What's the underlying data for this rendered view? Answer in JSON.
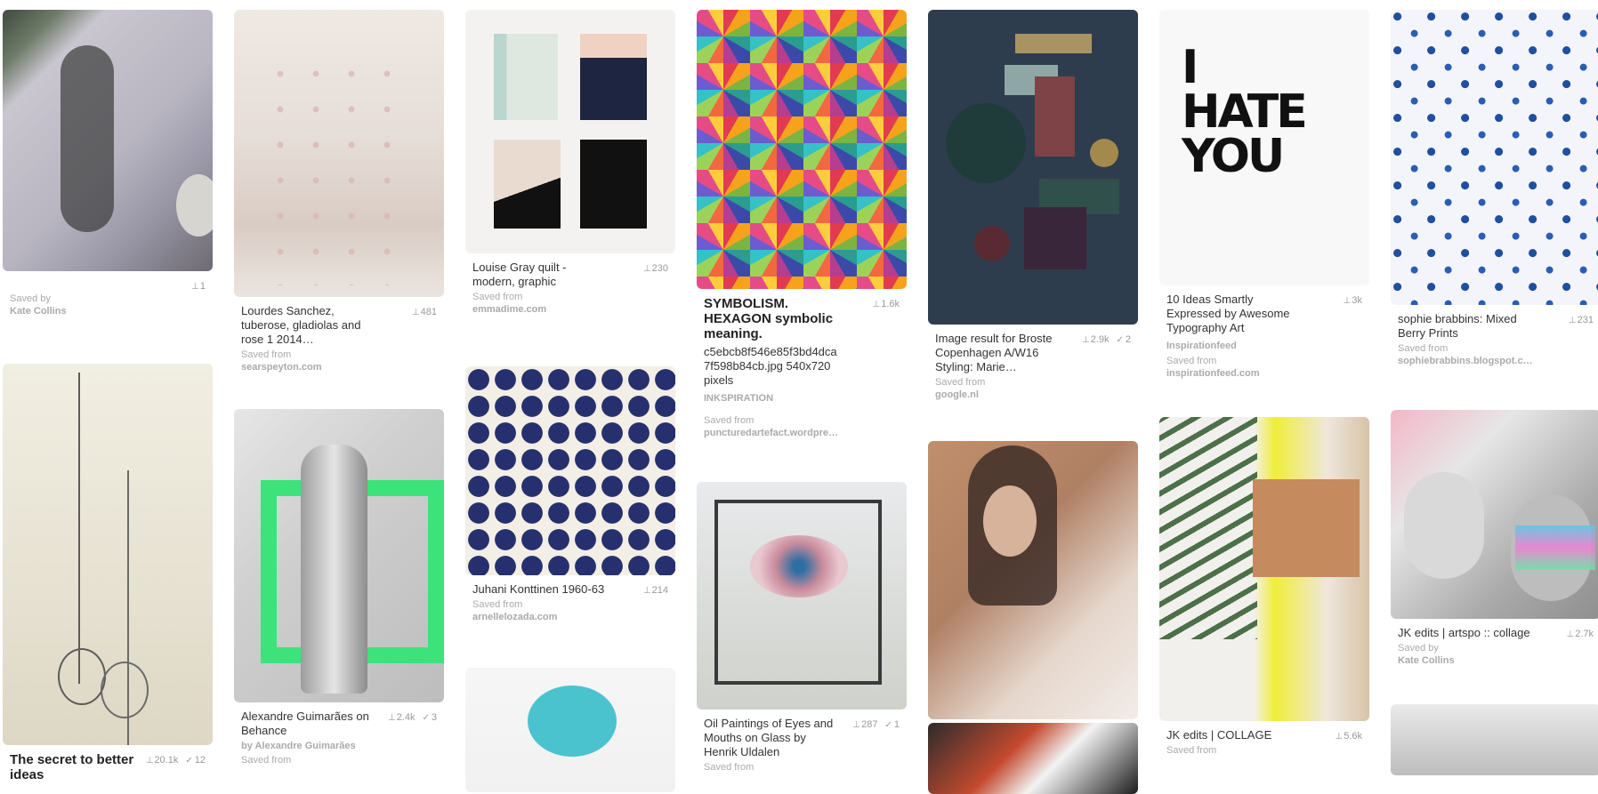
{
  "pins": {
    "p1": {
      "stats_pins": "1"
    },
    "p1_src_label": "Saved by",
    "p1_src": "Kate Collins",
    "p2": {
      "title": "Lourdes Sanchez, tuberose, gladiolas and rose 1 2014…",
      "stats_pins": "481",
      "src_label": "Saved from",
      "src": "searspeyton.com"
    },
    "p3": {
      "title": "Louise Gray quilt - modern, graphic",
      "stats_pins": "230",
      "src_label": "Saved from",
      "src": "emmadime.com"
    },
    "p4": {
      "title": "SYMBOLISM. HEXAGON symbolic meaning.",
      "stats_pins": "1.6k",
      "extra": "c5ebcb8f546e85f3bd4dca7f598b84cb.jpg 540x720 pixels",
      "brand": "INKSPIRATION",
      "src_label": "Saved from",
      "src": "puncturedartefact.wordpre…"
    },
    "p5": {
      "title": "Image result for Broste Copenhagen A/W16 Styling: Marie…",
      "stats_pins": "2.9k",
      "stats_checks": "2",
      "src_label": "Saved from",
      "src": "google.nl"
    },
    "p6": {
      "title": "10 Ideas Smartly Expressed by Awesome Typography Art",
      "stats_pins": "3k",
      "brand": "Inspirationfeed",
      "src_label": "Saved from",
      "src": "inspirationfeed.com"
    },
    "p7": {
      "title": "sophie brabbins: Mixed Berry Prints",
      "stats_pins": "231",
      "src_label": "Saved from",
      "src": "sophiebrabbins.blogspot.c…"
    },
    "p8": {
      "title": "The secret to better ideas",
      "stats_pins": "20.1k",
      "stats_checks": "12"
    },
    "p9": {
      "title": "Alexandre Guimarães on Behance",
      "stats_pins": "2.4k",
      "stats_checks": "3",
      "src_label": "by Alexandre Guimarães",
      "src2_label": "Saved from"
    },
    "p10": {
      "title": "Juhani Konttinen 1960-63",
      "stats_pins": "214",
      "src_label": "Saved from",
      "src": "arnellelozada.com"
    },
    "p11": {
      "title": "Oil Paintings of Eyes and Mouths on Glass by Henrik Uldalen",
      "stats_pins": "287",
      "stats_checks": "1",
      "src_label": "Saved from"
    },
    "p12": {
      "title": "JK edits | COLLAGE",
      "stats_pins": "5.6k",
      "src_label": "Saved from"
    },
    "p13": {
      "title": "JK edits | artspo :: collage",
      "stats_pins": "2.7k",
      "src_label": "Saved by",
      "src": "Kate Collins"
    }
  },
  "type_art": {
    "line1": "I",
    "line2": "HATE",
    "line3": "YOU"
  },
  "icons": {
    "pin": "pin-icon",
    "check": "check-icon"
  }
}
